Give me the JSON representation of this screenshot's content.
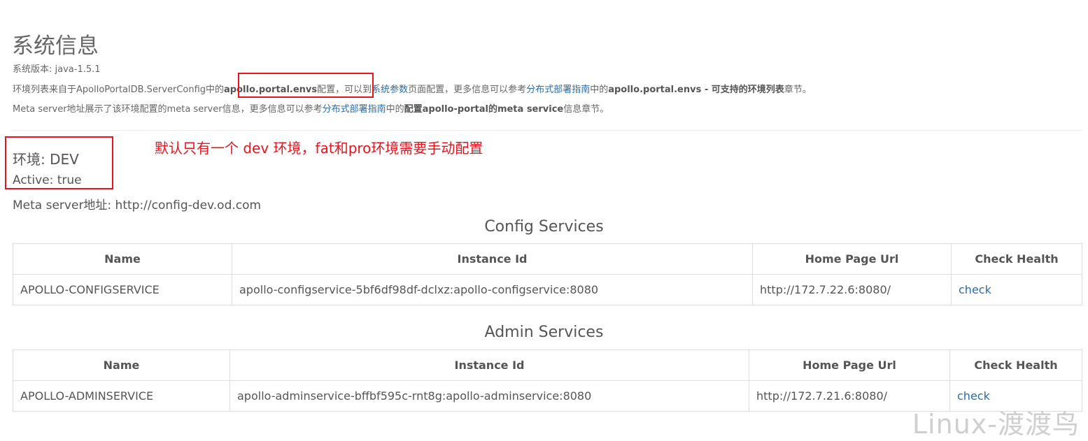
{
  "page": {
    "title": "系统信息",
    "version_text": "系统版本: java-1.5.1",
    "envs_line": {
      "p1": "环境列表来自于ApolloPortalDB.ServerConfig中的",
      "key": "apollo.portal.envs",
      "p2": "配置，可以到",
      "link1": "系统参数",
      "p3": "页面配置，更多信息可以参考",
      "link2": "分布式部署指南",
      "p4": "中的",
      "bold": "apollo.portal.envs - 可支持的环境列表",
      "p5": "章节。"
    },
    "meta_line": {
      "p1": "Meta server地址展示了该环境配置的meta server信息，更多信息可以参考",
      "link": "分布式部署指南",
      "p2": "中的",
      "bold": "配置apollo-portal的meta service",
      "p3": "信息章节。"
    }
  },
  "env": {
    "title": "环境: DEV",
    "active": "Active: true",
    "meta_server": "Meta server地址: http://config-dev.od.com"
  },
  "annotation": {
    "note": "默认只有一个 dev 环境，fat和pro环境需要手动配置",
    "color": "#e8131d"
  },
  "config_services": {
    "title": "Config Services",
    "headers": [
      "Name",
      "Instance Id",
      "Home Page Url",
      "Check Health"
    ],
    "row": {
      "name": "APOLLO-CONFIGSERVICE",
      "instance_id": "apollo-configservice-5bf6df98df-dclxz:apollo-configservice:8080",
      "home_page_url": "http://172.7.22.6:8080/",
      "check": "check"
    }
  },
  "admin_services": {
    "title": "Admin Services",
    "headers": [
      "Name",
      "Instance Id",
      "Home Page Url",
      "Check Health"
    ],
    "row": {
      "name": "APOLLO-ADMINSERVICE",
      "instance_id": "apollo-adminservice-bffbf595c-rnt8g:apollo-adminservice:8080",
      "home_page_url": "http://172.7.21.6:8080/",
      "check": "check"
    }
  },
  "watermark": "Linux-渡渡鸟",
  "colors": {
    "link": "#2b6ba8",
    "text": "#555555",
    "annotation": "#e8131d"
  }
}
